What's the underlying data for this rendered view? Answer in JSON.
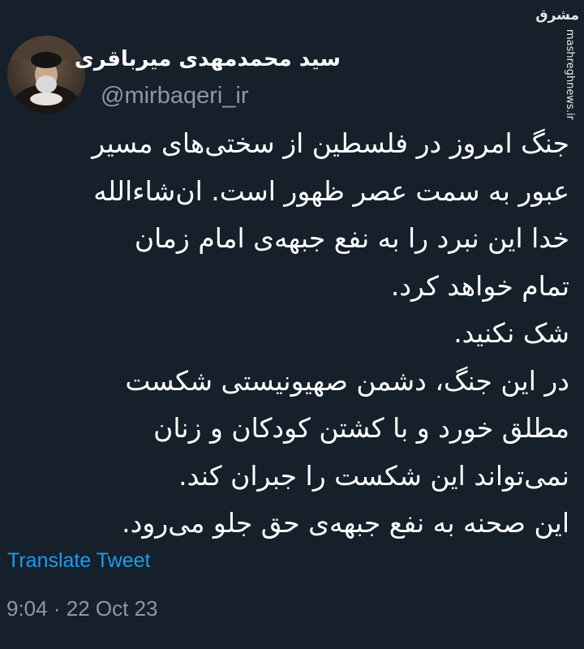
{
  "author": {
    "display_name": "سید محمدمهدی میرباقری",
    "handle": "@mirbaqeri_ir",
    "avatar_icon": "profile-photo"
  },
  "watermark": {
    "logo": "مشرق",
    "url": "mashreghnews.ir"
  },
  "tweet": {
    "lines": [
      "جنگ امروز در فلسطین از سختی‌های مسیر",
      "عبور به سمت عصر ظهور است. ان‌شاءالله",
      "خدا این نبرد را به نفع جبهه‌ی امام زمان",
      "تمام خواهد کرد.",
      "شک نکنید.",
      "در این جنگ، دشمن صهیونیستی شکست",
      "مطلق خورد و با کشتن کودکان و زنان",
      "نمی‌تواند این شکست را جبران کند.",
      "این صحنه به نفع جبهه‌ی حق جلو می‌رود."
    ]
  },
  "translate_label": "Translate Tweet",
  "meta": {
    "time": "9:04",
    "separator": "·",
    "date": "22 Oct 23"
  },
  "colors": {
    "background": "#15202b",
    "text": "#ffffff",
    "secondary": "#8b98a5",
    "link": "#1d9bf0"
  }
}
